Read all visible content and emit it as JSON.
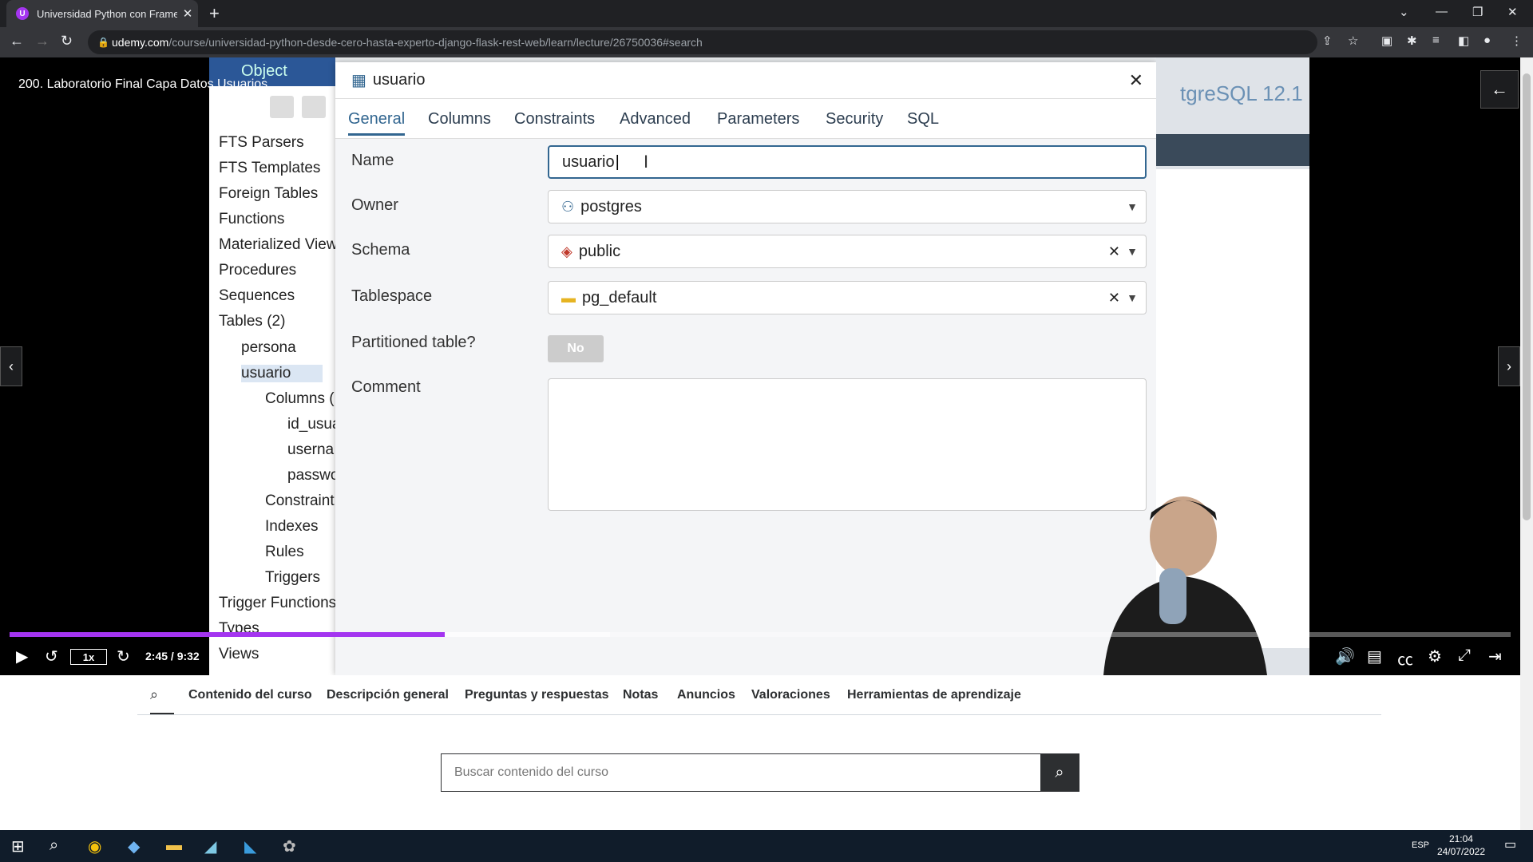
{
  "browser": {
    "tab_title": "Universidad Python con Framew",
    "url_domain": "udemy.com",
    "url_path": "/course/universidad-python-desde-cero-hasta-experto-django-flask-rest-web/learn/lecture/26750036#search"
  },
  "lecture": {
    "title": "200. Laboratorio Final Capa Datos Usuarios"
  },
  "pgadmin": {
    "menu_object": "Object",
    "tree": {
      "items": [
        "FTS Parsers",
        "FTS Templates",
        "Foreign Tables",
        "Functions",
        "Materialized View",
        "Procedures",
        "Sequences",
        "Tables (2)",
        "persona",
        "usuario",
        "Columns (",
        "id_usua",
        "userna",
        "passwo",
        "Constraint",
        "Indexes",
        "Rules",
        "Triggers",
        "Trigger Functions",
        "Types",
        "Views"
      ]
    },
    "dialog": {
      "title": "usuario",
      "tabs": [
        "General",
        "Columns",
        "Constraints",
        "Advanced",
        "Parameters",
        "Security",
        "SQL"
      ],
      "active_tab": "General",
      "fields": {
        "name_label": "Name",
        "name_value": "usuario",
        "owner_label": "Owner",
        "owner_value": "postgres",
        "schema_label": "Schema",
        "schema_value": "public",
        "tablespace_label": "Tablespace",
        "tablespace_value": "pg_default",
        "partitioned_label": "Partitioned table?",
        "partitioned_value": "No",
        "comment_label": "Comment"
      }
    },
    "watermark": "tgreSQL 12.1"
  },
  "player": {
    "speed": "1x",
    "time": "2:45 / 9:32",
    "progress_fraction": 0.29,
    "buffered_fraction": 0.4
  },
  "course_nav": {
    "tabs": [
      "Contenido del curso",
      "Descripción general",
      "Preguntas y respuestas",
      "Notas",
      "Anuncios",
      "Valoraciones",
      "Herramientas de aprendizaje"
    ]
  },
  "search": {
    "placeholder": "Buscar contenido del curso"
  },
  "taskbar": {
    "lang": "ESP",
    "time": "21:04",
    "date": "24/07/2022"
  },
  "colors": {
    "udemy_purple": "#a435f0",
    "pgadmin_blue": "#326690"
  }
}
